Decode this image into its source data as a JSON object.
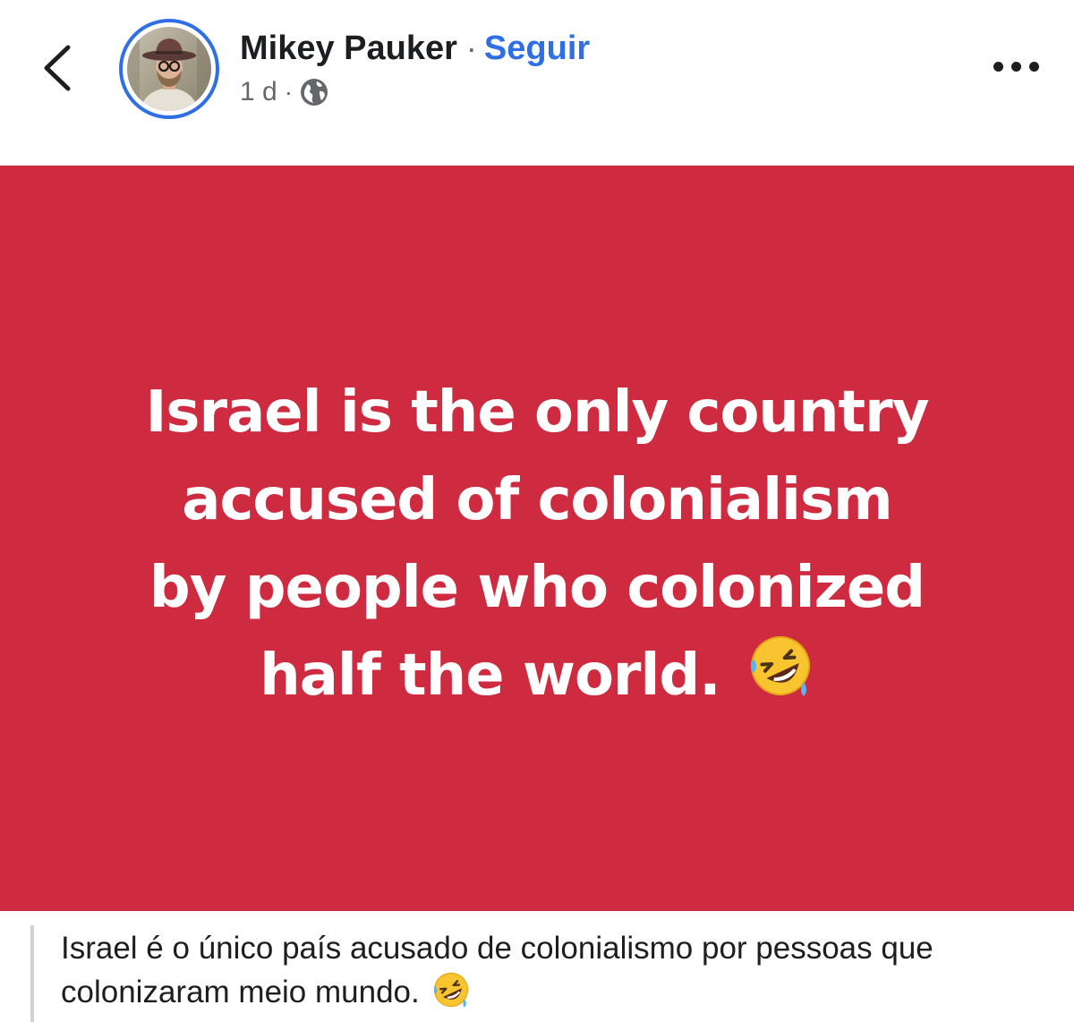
{
  "header": {
    "author_name": "Mikey Pauker",
    "separator": "·",
    "follow_label": "Seguir",
    "timestamp": "1 d",
    "meta_separator": "·",
    "privacy_icon": "globe-icon",
    "back_icon": "chevron-left-icon",
    "more_icon": "more-dots-icon"
  },
  "post": {
    "lines": [
      "Israel is the only country",
      "accused of colonialism",
      "by people who colonized",
      "half the world."
    ],
    "emoji": "rolling-on-floor-laughing-emoji",
    "background_color": "#cf2b40",
    "text_color": "#ffffff"
  },
  "translation": {
    "text": "Israel é o único país acusado de colonialismo por pessoas que colonizaram meio mundo.",
    "emoji": "rolling-on-floor-laughing-emoji"
  },
  "colors": {
    "accent": "#2f6fe6",
    "secondary_text": "#65676b",
    "primary_text": "#1c1e21"
  }
}
